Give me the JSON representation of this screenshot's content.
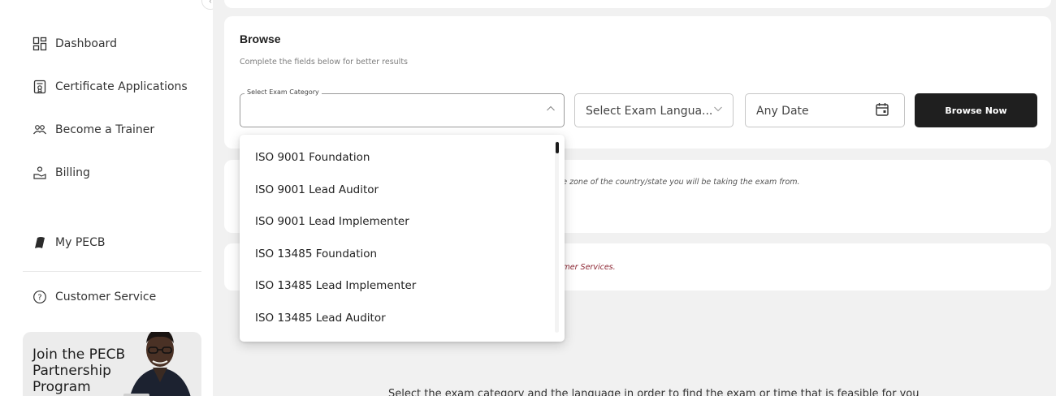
{
  "sidebar": {
    "items": [
      {
        "label": "Dashboard",
        "icon": "dashboard-icon"
      },
      {
        "label": "Certificate Applications",
        "icon": "certificate-icon"
      },
      {
        "label": "Become a Trainer",
        "icon": "trainer-icon"
      },
      {
        "label": "Billing",
        "icon": "billing-icon"
      },
      {
        "label": "My PECB",
        "icon": "my-pecb-icon"
      },
      {
        "label": "Customer Service",
        "icon": "help-circle-icon"
      }
    ],
    "promo": {
      "text": "Join the PECB Partnership Program"
    }
  },
  "browse": {
    "title": "Browse",
    "subtitle": "Complete the fields below for better results",
    "category_legend": "Select Exam Category",
    "language_placeholder": "Select Exam Langua...",
    "date_placeholder": "Any Date",
    "button_label": "Browse Now"
  },
  "notes": {
    "timezone": "me zone of the country/state you will be taking the exam from.",
    "customer_services": "tomer Services."
  },
  "bottom_text": "Select the exam category and the language in order to find the exam or time that is feasible for you",
  "dropdown": {
    "options": [
      "ISO 9001 Foundation",
      "ISO 9001 Lead Auditor",
      "ISO 9001 Lead Implementer",
      "ISO 13485 Foundation",
      "ISO 13485 Lead Implementer",
      "ISO 13485 Lead Auditor"
    ]
  },
  "colors": {
    "button_bg": "#1f1f1f",
    "accent_red": "#8b2330",
    "main_bg": "#f1f1f1"
  }
}
